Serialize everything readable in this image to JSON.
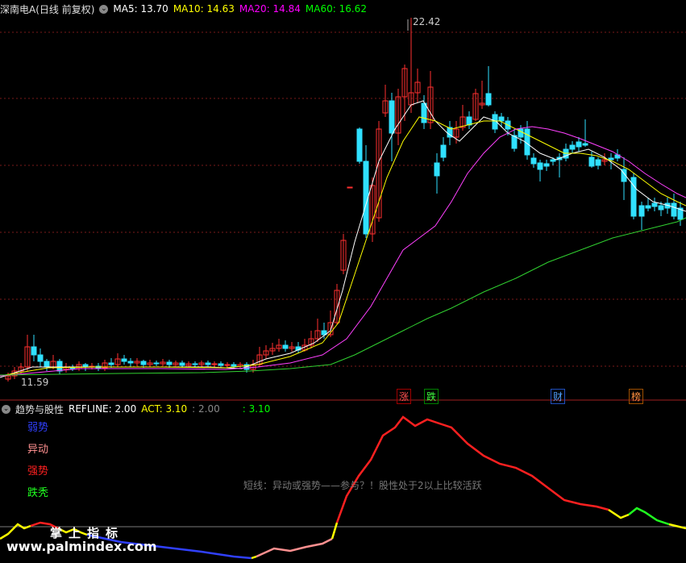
{
  "header": {
    "title": "深南电A(日线 前复权)",
    "ma5": "MA5: 13.70",
    "ma10": "MA10: 14.63",
    "ma20": "MA20: 14.84",
    "ma60": "MA60: 16.62",
    "colors": {
      "ma5": "#ffffff",
      "ma10": "#ffff00",
      "ma20": "#ff00ff",
      "ma60": "#00ff00"
    }
  },
  "price_chart": {
    "high_label": "22.42",
    "low_label": "11.59",
    "event_tags": [
      {
        "text": "涨",
        "color": "#ff4040",
        "bg": "#ff2020"
      },
      {
        "text": "跌",
        "color": "#40ff40",
        "bg": "#00c000"
      },
      {
        "text": "财",
        "color": "#40a0ff",
        "bg": "#2060ff"
      },
      {
        "text": "榜",
        "color": "#ffa040",
        "bg": "#c06000"
      }
    ]
  },
  "indicator": {
    "title": "趋势与股性",
    "refline": "REFLINE: 2.00",
    "act": "ACT: 3.10",
    "v1": ": 2.00",
    "v2": ": 3.10",
    "legend": [
      {
        "text": "弱势",
        "color": "#3040ff"
      },
      {
        "text": "异动",
        "color": "#ff9090"
      },
      {
        "text": "强势",
        "color": "#ff2020"
      },
      {
        "text": "跌秃",
        "color": "#20ff20"
      }
    ],
    "note": "短线：异动或强势——参与？！股性处于2以上比较活跃"
  },
  "watermark": {
    "line1": "掌上指标",
    "line2": "www.palmindex.com"
  },
  "chart_data": [
    {
      "type": "line",
      "title": "深南电A(日线 前复权)",
      "note": "Candlestick price chart with moving averages; MA values as shown in header",
      "y_labels": {
        "high": 22.42,
        "low": 11.59
      },
      "series": [
        {
          "name": "MA5",
          "last": 13.7
        },
        {
          "name": "MA10",
          "last": 14.63
        },
        {
          "name": "MA20",
          "last": 14.84
        },
        {
          "name": "MA60",
          "last": 16.62
        }
      ]
    },
    {
      "type": "line",
      "title": "趋势与股性",
      "series": [
        {
          "name": "REFLINE",
          "last": 2.0
        },
        {
          "name": "ACT",
          "last": 3.1
        }
      ]
    }
  ]
}
